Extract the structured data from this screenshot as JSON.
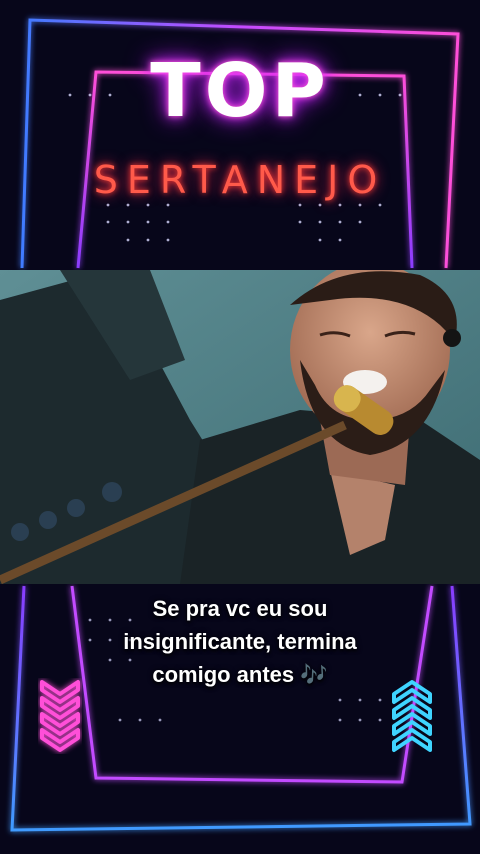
{
  "poster": {
    "title": "TOP",
    "subtitle": "SERTANEJO"
  },
  "caption": {
    "line1": "Se pra vc eu sou",
    "line2": "insignificante, termina",
    "line3": "comigo antes 🎶"
  },
  "colors": {
    "background": "#07061a",
    "neon_pink": "#ff4fd8",
    "neon_purple": "#a93cff",
    "neon_blue": "#3f7bff",
    "neon_cyan": "#3fd4ff",
    "subtitle_red": "#ff5a4a"
  },
  "icons": {
    "left_arrows": "chevrons-down-icon",
    "right_arrows": "chevrons-up-icon"
  }
}
